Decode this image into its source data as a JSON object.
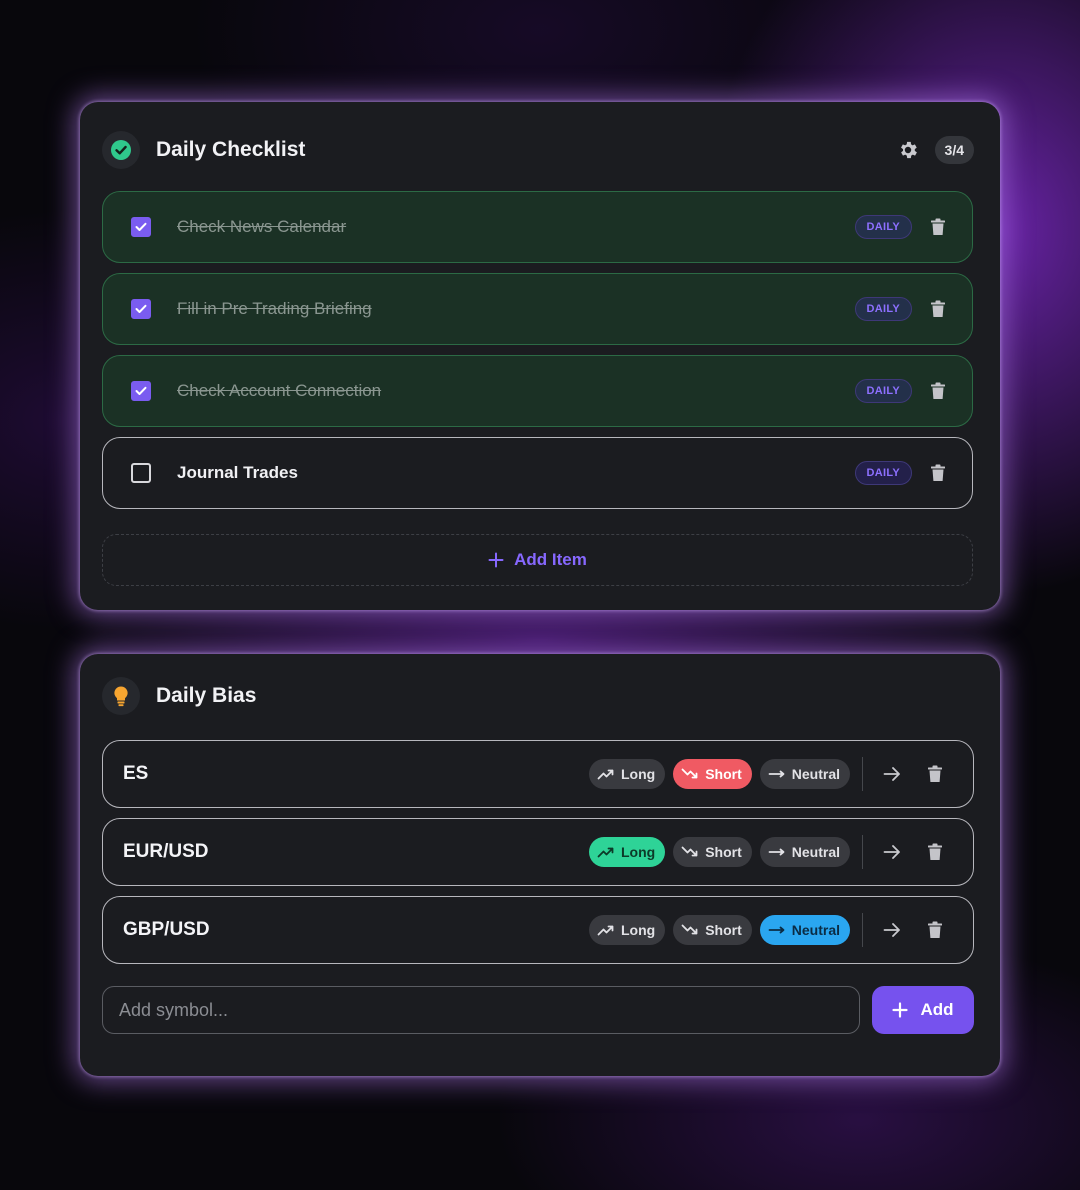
{
  "checklist": {
    "title": "Daily Checklist",
    "counter": "3/4",
    "items": [
      {
        "label": "Check News Calendar",
        "badge": "DAILY",
        "done": true
      },
      {
        "label": "Fill in Pre Trading Briefing",
        "badge": "DAILY",
        "done": true
      },
      {
        "label": "Check Account Connection",
        "badge": "DAILY",
        "done": true
      },
      {
        "label": "Journal Trades",
        "badge": "DAILY",
        "done": false
      }
    ],
    "add_label": "Add Item"
  },
  "bias": {
    "title": "Daily Bias",
    "options": {
      "long": "Long",
      "short": "Short",
      "neutral": "Neutral"
    },
    "rows": [
      {
        "symbol": "ES",
        "selected": "short"
      },
      {
        "symbol": "EUR/USD",
        "selected": "long"
      },
      {
        "symbol": "GBP/USD",
        "selected": "neutral"
      }
    ],
    "input_placeholder": "Add symbol...",
    "add_label": "Add"
  },
  "colors": {
    "accent": "#7652ee",
    "long": "#2ed397",
    "short": "#f05a63",
    "neutral": "#2aa6f0",
    "done_bg": "#1b3125"
  }
}
